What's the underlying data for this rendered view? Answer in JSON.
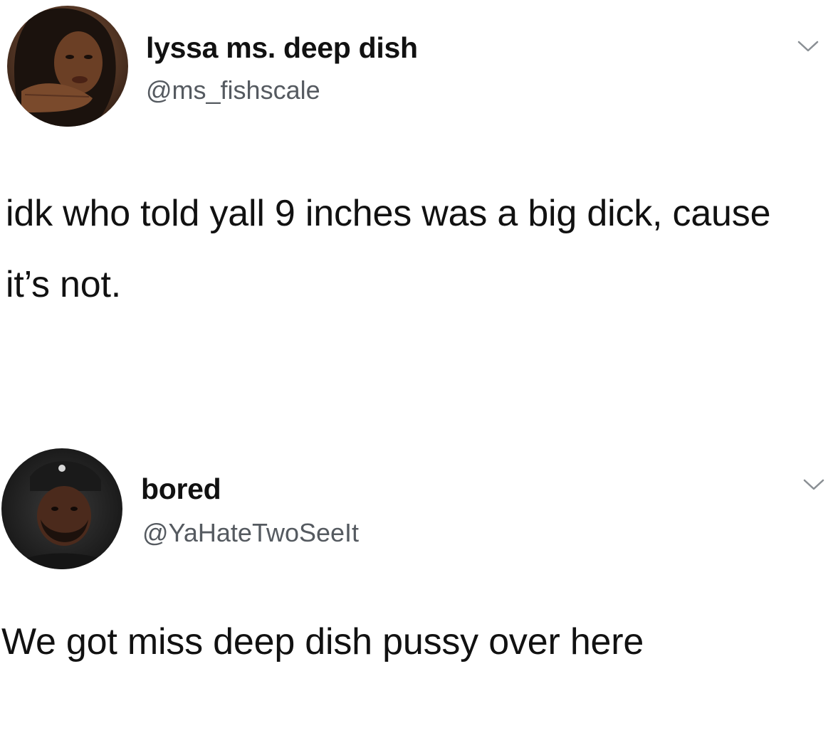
{
  "tweets": [
    {
      "display_name": "lyssa ms. deep dish",
      "handle": "@ms_fishscale",
      "text": "idk who told yall 9 inches was a big dick, cause it’s not.",
      "avatar_icon": "profile-photo-woman",
      "menu_icon": "chevron-down-icon"
    },
    {
      "display_name": "bored",
      "handle": "@YaHateTwoSeeIt",
      "text": "We got miss deep dish pussy over here",
      "avatar_icon": "profile-photo-man",
      "menu_icon": "chevron-down-icon"
    }
  ],
  "colors": {
    "background": "#ffffff",
    "text": "#111111",
    "handle": "#555a60",
    "chevron": "#8a8f94"
  }
}
